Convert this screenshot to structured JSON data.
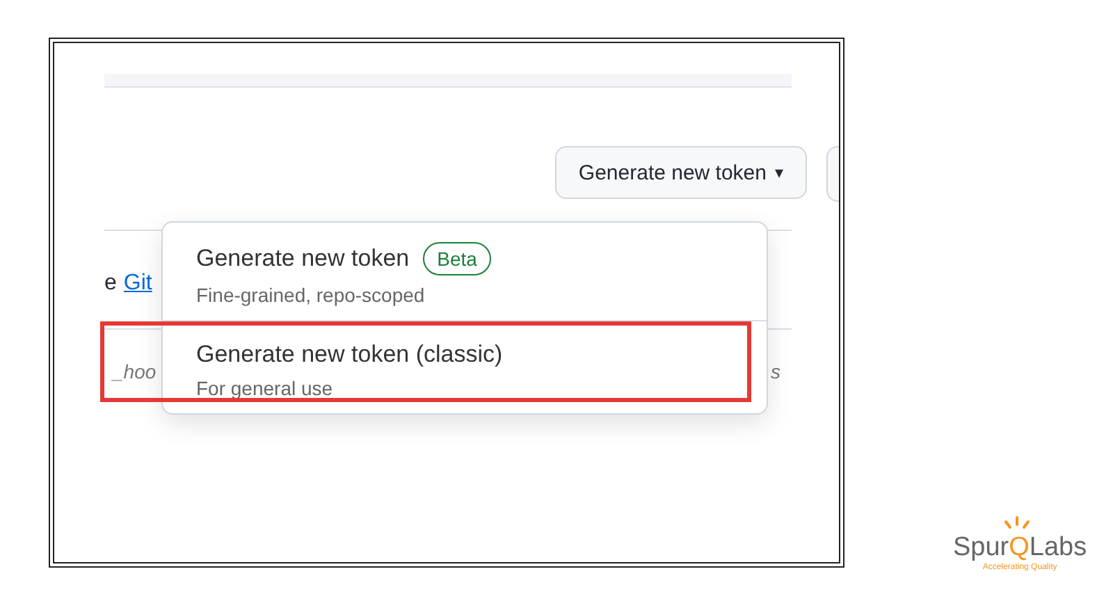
{
  "toolbar": {
    "button": {
      "label": "Generate new token",
      "caret": "▾"
    }
  },
  "background_text": {
    "prefix": "e",
    "link": "Git",
    "code_fragment": "_hoo",
    "trailing": "s"
  },
  "menu": {
    "items": [
      {
        "title": "Generate new token",
        "badge": "Beta",
        "subtitle": "Fine-grained, repo-scoped",
        "highlighted": false
      },
      {
        "title": "Generate new token (classic)",
        "subtitle": "For general use",
        "highlighted": true
      }
    ]
  },
  "logo": {
    "name_start": "Spur",
    "name_mark": "Q",
    "name_end": "Labs",
    "tagline": "Accelerating Quality"
  }
}
